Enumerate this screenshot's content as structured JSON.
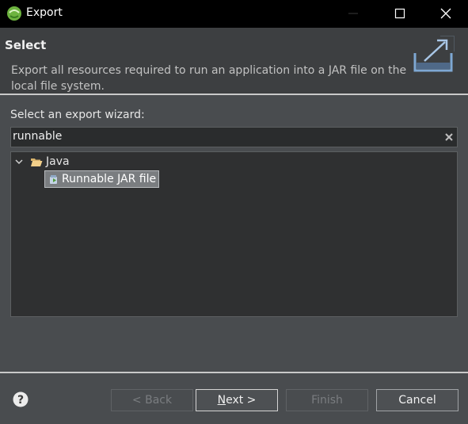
{
  "window": {
    "title": "Export"
  },
  "header": {
    "title": "Select",
    "description": "Export all resources required to run an application into a JAR file on the local file system."
  },
  "wizard": {
    "prompt": "Select an export wizard:",
    "filter_value": "runnable",
    "tree": [
      {
        "label": "Java",
        "expanded": true,
        "children": [
          {
            "label": "Runnable JAR file",
            "selected": true
          }
        ]
      }
    ]
  },
  "buttons": {
    "back": "< Back",
    "next_mnemonic": "N",
    "next_rest": "ext >",
    "finish": "Finish",
    "cancel": "Cancel"
  },
  "icons": {
    "app": "eclipse-icon",
    "help": "help-icon",
    "clear": "clear-icon",
    "folder": "open-folder-icon",
    "jar": "runnable-jar-icon",
    "wizard_banner": "export-wizard-icon"
  },
  "colors": {
    "titlebar": "#000000",
    "dialog_bg": "#494c4f",
    "header_bg": "#3d3f41",
    "tree_bg": "#2f3031",
    "selection_bg": "#7a7d80"
  }
}
